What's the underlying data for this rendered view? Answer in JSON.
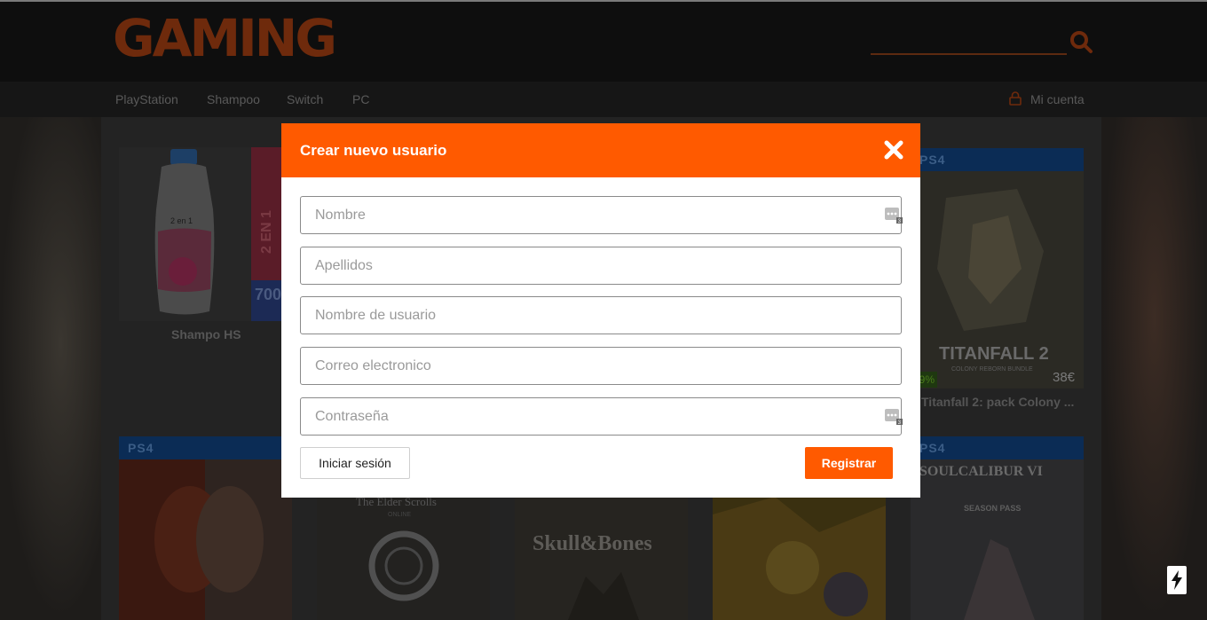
{
  "site": {
    "logo": "GAMING",
    "nav": [
      {
        "label": "PlayStation"
      },
      {
        "label": "Shampoo"
      },
      {
        "label": "Switch"
      },
      {
        "label": "PC"
      }
    ],
    "account_label": "Mi cuenta"
  },
  "products": {
    "shampoo_title": "Shampo HS",
    "shampoo_bottle_text": "2 en 1",
    "box_text": "2 EN 1",
    "box_ml": "700",
    "platform_badge": "PS4",
    "titanfall_box": "TITANFALL 2",
    "titanfall_subtitle": "COLONY REBORN BUNDLE",
    "titanfall_title": "Titanfall 2: pack Colony ...",
    "titanfall_price": "38€",
    "titanfall_discount": "29%",
    "elder_title": "The Elder Scrolls",
    "elder_sub": "ONLINE",
    "skull_title": "Skull&Bones",
    "soulcalibur_title": "SOULCALIBUR VI",
    "soulcalibur_sub": "SEASON PASS"
  },
  "modal": {
    "title": "Crear nuevo usuario",
    "fields": [
      {
        "placeholder": "Nombre",
        "value": ""
      },
      {
        "placeholder": "Apellidos",
        "value": ""
      },
      {
        "placeholder": "Nombre de usuario",
        "value": ""
      },
      {
        "placeholder": "Correo electronico",
        "value": ""
      },
      {
        "placeholder": "Contraseña",
        "value": ""
      }
    ],
    "password_manager_count": "3",
    "login_label": "Iniciar sesión",
    "register_label": "Registrar"
  },
  "colors": {
    "accent": "#ff5a00",
    "header_bg": "#0e0e0e",
    "ps4_band": "#0b2c55"
  }
}
